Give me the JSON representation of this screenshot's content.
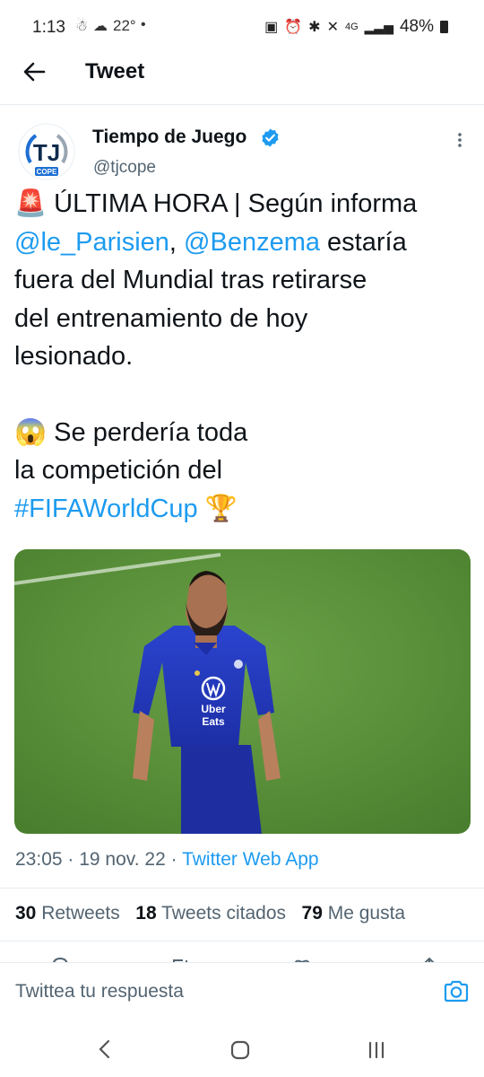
{
  "status_bar": {
    "time": "1:13",
    "temperature": "22°",
    "network": "4G",
    "battery": "48%"
  },
  "header": {
    "title": "Tweet"
  },
  "tweet": {
    "author": {
      "name": "Tiempo de Juego",
      "handle": "@tjcope",
      "avatar_text": "TJ",
      "avatar_subtext": "COPE"
    },
    "text": {
      "line1_emoji": "🚨",
      "line1": "ÚLTIMA HORA | Según informa",
      "mention1": "@le_Parisien",
      "sep": ", ",
      "mention2": "@Benzema",
      "line2_rest": " estaría",
      "line3": "fuera del Mundial tras retirarse",
      "line4": "del entrenamiento de hoy",
      "line5": "lesionado.",
      "line6_emoji": "😱",
      "line6": "Se perdería toda",
      "line7": "la competición del",
      "hashtag": "#FIFAWorldCup",
      "trophy": "🏆"
    },
    "image": {
      "jersey_brand": "Uber",
      "jersey_brand2": "Eats"
    },
    "meta": {
      "time": "23:05",
      "dot1": " · ",
      "date": "19 nov. 22",
      "dot2": " · ",
      "source": "Twitter Web App"
    },
    "stats": {
      "retweets_count": "30",
      "retweets_label": "Retweets",
      "quotes_count": "18",
      "quotes_label": "Tweets citados",
      "likes_count": "79",
      "likes_label": "Me gusta"
    }
  },
  "reply": {
    "placeholder": "Twittea tu respuesta"
  },
  "icons": {
    "back": "arrow-left",
    "verified": "verified-badge",
    "more": "vertical-ellipsis",
    "camera": "camera",
    "nav_back": "chevron-left",
    "nav_home": "circle",
    "nav_recent": "three-bars"
  },
  "colors": {
    "link": "#1d9bf0",
    "text": "#0f1419",
    "secondary": "#536471",
    "pitch": "#5f9a3a",
    "jersey": "#2436b8"
  }
}
